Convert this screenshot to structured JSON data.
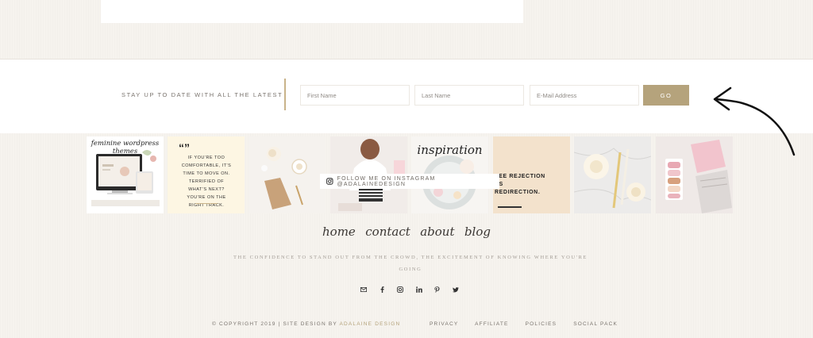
{
  "colors": {
    "accent": "#b5a37c",
    "background": "#f6f3ee",
    "divider": "#c9b38a"
  },
  "newsletter": {
    "label": "STAY UP TO DATE WITH ALL THE LATEST",
    "first_name_placeholder": "First Name",
    "last_name_placeholder": "Last Name",
    "email_placeholder": "E-Mail Address",
    "submit_label": "GO"
  },
  "instagram": {
    "follow_label": "FOLLOW ME ON INSTAGRAM @ADALAINEDESIGN",
    "tiles": [
      {
        "name": "feminine-wordpress-themes",
        "caption": "feminine wordpress themes"
      },
      {
        "name": "quote-comfortable",
        "quote_mark": "“”",
        "caption": "IF YOU'RE TOO COMFORTABLE, IT'S TIME TO MOVE ON. TERRIFIED OF WHAT'S NEXT? YOU'RE ON THE RIGHT TRACK."
      },
      {
        "name": "flatlay-flowers",
        "caption": ""
      },
      {
        "name": "woman-laptop",
        "caption": ""
      },
      {
        "name": "inspiration",
        "caption": "inspiration"
      },
      {
        "name": "quote-rejection",
        "caption": "SEE REJECTION AS REDIRECTION."
      },
      {
        "name": "marble-roses",
        "caption": ""
      },
      {
        "name": "macarons-notebook",
        "caption": ""
      }
    ]
  },
  "footer": {
    "nav": [
      "home",
      "contact",
      "about",
      "blog"
    ],
    "tagline": "THE CONFIDENCE TO STAND OUT FROM THE CROWD, THE EXCITEMENT OF KNOWING WHERE YOU'RE GOING",
    "socials": [
      "mail-icon",
      "facebook-icon",
      "instagram-icon",
      "linkedin-icon",
      "pinterest-icon",
      "twitter-icon"
    ],
    "copyright_prefix": "© COPYRIGHT 2019 | SITE DESIGN BY ",
    "copyright_brand": "ADALAINE DESIGN",
    "links": [
      "PRIVACY",
      "AFFILIATE",
      "POLICIES",
      "SOCIAL PACK"
    ]
  }
}
